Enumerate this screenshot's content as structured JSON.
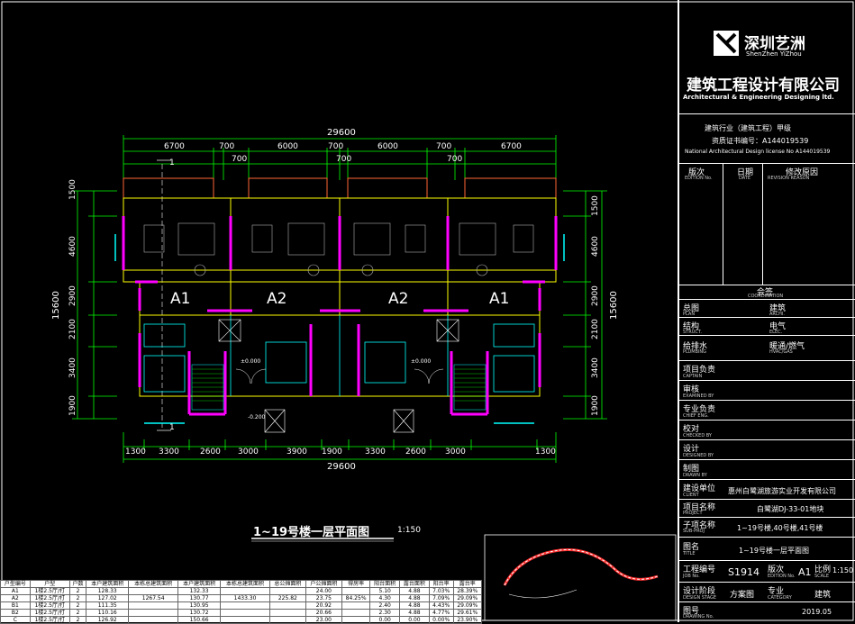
{
  "company": {
    "logo_cn": "深圳艺洲",
    "logo_en": "ShenZhen YiZhou",
    "name_cn": "建筑工程设计有限公司",
    "name_en": "Architectural & Engineering Designing ltd."
  },
  "certification": {
    "line1": "建筑行业（建筑工程）甲级",
    "line2": "资质证书编号：A144019539",
    "line3": "National Architectural Design license No A144019539"
  },
  "revision": {
    "col1_cn": "版次",
    "col1_en": "EDITION No.",
    "col2_cn": "日期",
    "col2_en": "DATE",
    "col3_cn": "修改原因",
    "col3_en": "REVISION REASON"
  },
  "coordination": {
    "title_cn": "会签",
    "title_en": "COORDINATION"
  },
  "disciplines": [
    {
      "a_cn": "总图",
      "a_en": "PLAN",
      "b_cn": "建筑",
      "b_en": "ARCHI."
    },
    {
      "a_cn": "结构",
      "a_en": "STRUCT.",
      "b_cn": "电气",
      "b_en": "ELEC."
    },
    {
      "a_cn": "给排水",
      "a_en": "PLUMBING",
      "b_cn": "暖通/燃气",
      "b_en": "HVAC/GAS"
    }
  ],
  "roles": [
    {
      "cn": "项目负责",
      "en": "CAPTAIN"
    },
    {
      "cn": "审核",
      "en": "EXAMINED BY"
    },
    {
      "cn": "专业负责",
      "en": "CHIEF ENG."
    },
    {
      "cn": "校对",
      "en": "CHECKED BY"
    },
    {
      "cn": "设计",
      "en": "DESIGNED BY"
    },
    {
      "cn": "制图",
      "en": "DRAWN BY"
    }
  ],
  "client": {
    "label_cn": "建设单位",
    "label_en": "CLIENT",
    "value": "惠州白鹭湖旅游实业开发有限公司"
  },
  "project": {
    "label_cn": "项目名称",
    "label_en": "PROJECT",
    "value": "白鹭湖DJ-33-01地块"
  },
  "subproject": {
    "label_cn": "子项名称",
    "label_en": "SUB-PROJ",
    "value": "1~19号楼,40号楼,41号楼"
  },
  "drawing_title": {
    "label_cn": "图名",
    "label_en": "TITLE",
    "value": "1~19号楼一层平面图"
  },
  "job": {
    "label_cn": "工程编号",
    "label_en": "JOB No.",
    "value": "S1914",
    "edition_cn": "版次",
    "edition_en": "EDITION No.",
    "edition": "A1",
    "scale_cn": "比例",
    "scale_en": "SCALE",
    "scale": "1:150"
  },
  "stage": {
    "label_cn": "设计阶段",
    "label_en": "DESIGN STAGE",
    "value": "方案图",
    "cat_cn": "专业",
    "cat_en": "CATEGORY",
    "cat": "建筑"
  },
  "drawing_no": {
    "label_cn": "图号",
    "label_en": "DRAWING No.",
    "date": "2019.05"
  },
  "plan": {
    "title": "1~19号楼一层平面图",
    "scale": "1:150",
    "total_width": "29600",
    "top_dims": [
      "6700",
      "700",
      "6000",
      "700",
      "6000",
      "700",
      "6700"
    ],
    "top_dims2": [
      "700",
      "700",
      "700"
    ],
    "bottom_dims": [
      "1300",
      "3300",
      "2600",
      "3000",
      "3900",
      "1900",
      "3300",
      "2600",
      "3000",
      "1300"
    ],
    "left_dims": [
      "1500",
      "4600",
      "2900",
      "2100",
      "3400",
      "1900"
    ],
    "left_total": "15600",
    "right_dims": [
      "1500",
      "4600",
      "2900",
      "2100",
      "3400",
      "1900"
    ],
    "right_total": "15600",
    "unit_labels": [
      "A1",
      "A2",
      "A2",
      "A1"
    ],
    "axis_top": "1",
    "axis_bottom": "1",
    "elevations": [
      "±0.000",
      "±0.000",
      "-0.200"
    ]
  },
  "schedule": {
    "headers": [
      "户型编号",
      "户型",
      "户数",
      "本户建筑面积",
      "本栋总建筑面积",
      "本户建筑面积",
      "本栋总建筑面积",
      "总公摊面积",
      "户公摊面积",
      "得房率",
      "阳台面积",
      "露台面积",
      "阳台率",
      "露台率"
    ],
    "rows": [
      [
        "A1",
        "1楼2.5厅/打",
        "2",
        "128.33",
        "",
        "132.33",
        "",
        "",
        "24.00",
        "",
        "5.10",
        "4.88",
        "7.03%",
        "28.39%"
      ],
      [
        "A2",
        "1楼2.5厅/打",
        "2",
        "127.02",
        "1267.54",
        "130.77",
        "1433.30",
        "225.82",
        "23.75",
        "84.25%",
        "4.30",
        "4.88",
        "7.09%",
        "29.09%"
      ],
      [
        "B1",
        "1楼2.5厅/打",
        "2",
        "111.35",
        "",
        "130.95",
        "",
        "",
        "20.92",
        "",
        "2.40",
        "4.88",
        "4.43%",
        "29.09%"
      ],
      [
        "B2",
        "1楼2.5厅/打",
        "2",
        "110.16",
        "",
        "130.72",
        "",
        "",
        "20.66",
        "",
        "2.30",
        "4.88",
        "4.77%",
        "29.61%"
      ],
      [
        "C",
        "1楼2.5厅/打",
        "2",
        "126.92",
        "",
        "150.66",
        "",
        "",
        "23.00",
        "",
        "0.00",
        "0.00",
        "0.00%",
        "23.90%"
      ]
    ]
  },
  "colors": {
    "line_yellow": "#ffff00",
    "line_magenta": "#ff00ff",
    "line_cyan": "#00ffff",
    "line_green": "#00ff00",
    "line_red": "#ff3333",
    "furniture": "#b0b0b0"
  }
}
